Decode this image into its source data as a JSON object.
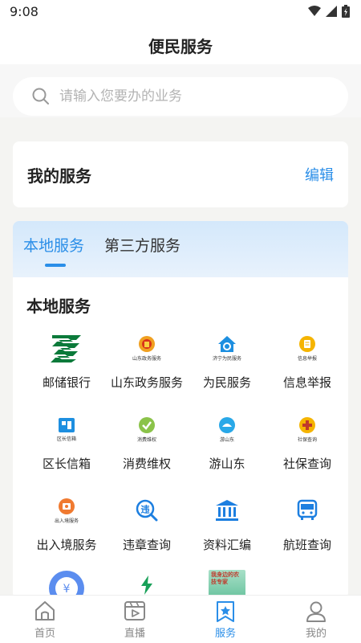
{
  "status_bar": {
    "time": "9:08"
  },
  "header": {
    "title": "便民服务"
  },
  "search": {
    "placeholder": "请输入您要办的业务"
  },
  "my_services": {
    "title": "我的服务",
    "edit_label": "编辑"
  },
  "tabs": [
    {
      "label": "本地服务",
      "active": true
    },
    {
      "label": "第三方服务",
      "active": false
    }
  ],
  "local_services": {
    "title": "本地服务",
    "items": [
      {
        "label": "邮储银行",
        "icon": "postal-bank-icon"
      },
      {
        "label": "山东政务服务",
        "icon": "shandong-gov-icon",
        "icon_caption": "山东政务服务"
      },
      {
        "label": "为民服务",
        "icon": "jining-service-icon",
        "icon_caption": "济宁为民服务"
      },
      {
        "label": "信息举报",
        "icon": "info-report-icon",
        "icon_caption": "信息举报"
      },
      {
        "label": "区长信箱",
        "icon": "district-mailbox-icon",
        "icon_caption": "区长信箱"
      },
      {
        "label": "消费维权",
        "icon": "consumer-rights-icon",
        "icon_caption": "消费维权"
      },
      {
        "label": "游山东",
        "icon": "tour-shandong-icon",
        "icon_caption": "游山东"
      },
      {
        "label": "社保查询",
        "icon": "social-security-icon",
        "icon_caption": "社保查询"
      },
      {
        "label": "出入境服务",
        "icon": "immigration-icon",
        "icon_caption": "出入境服务"
      },
      {
        "label": "违章查询",
        "icon": "violation-query-icon"
      },
      {
        "label": "资料汇编",
        "icon": "archive-icon"
      },
      {
        "label": "航班查询",
        "icon": "bus-icon"
      },
      {
        "label": "",
        "icon": "yuan-coin-icon"
      },
      {
        "label": "",
        "icon": "lightning-icon"
      },
      {
        "label": "",
        "icon": "farm-expert-icon",
        "icon_caption": "我身边的农技专家"
      }
    ]
  },
  "tabbar": [
    {
      "label": "首页",
      "icon": "home-icon",
      "active": false
    },
    {
      "label": "直播",
      "icon": "live-video-icon",
      "active": false
    },
    {
      "label": "服务",
      "icon": "service-star-icon",
      "active": true
    },
    {
      "label": "我的",
      "icon": "profile-icon",
      "active": false
    }
  ],
  "colors": {
    "accent": "#2a8ee8",
    "postal_green": "#0b7a3a",
    "gov_orange": "#f0a020"
  }
}
